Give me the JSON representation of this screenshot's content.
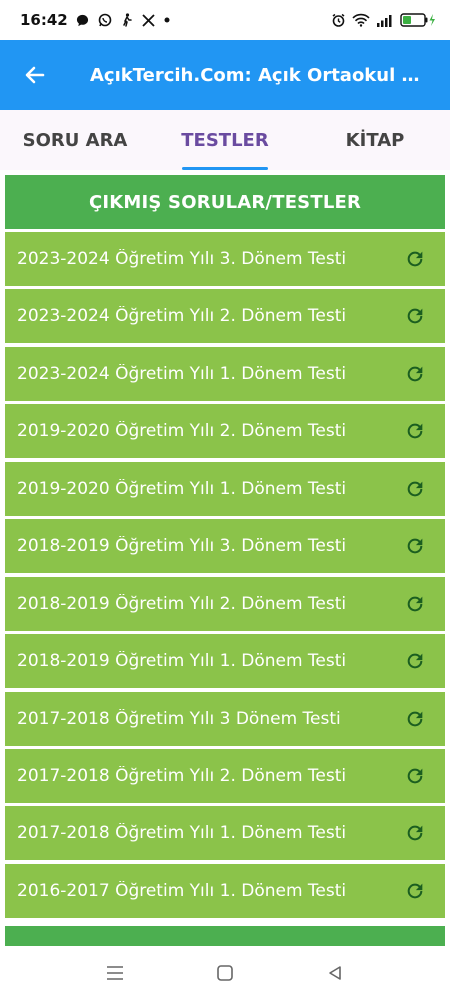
{
  "status_bar": {
    "time": "16:42",
    "left_icons": [
      "chat-bubble-icon",
      "whatsapp-icon",
      "walking-person-icon",
      "x-logo-icon",
      "dot-icon"
    ],
    "right_icons": [
      "alarm-icon",
      "wifi-icon",
      "signal-icon",
      "battery-charging-icon"
    ]
  },
  "app_bar": {
    "title": "AçıkTercih.Com: Açık Ortaokul Uygulaması",
    "color": "#2196f3"
  },
  "tabs": [
    {
      "label": "SORU ARA",
      "active": false
    },
    {
      "label": "TESTLER",
      "active": true
    },
    {
      "label": "KİTAP",
      "active": false
    }
  ],
  "section": {
    "header": "ÇIKMIŞ SORULAR/TESTLER",
    "items": [
      {
        "label": "2023-2024 Öğretim Yılı 3. Dönem Testi"
      },
      {
        "label": "2023-2024 Öğretim Yılı 2. Dönem Testi"
      },
      {
        "label": "2023-2024 Öğretim Yılı 1. Dönem Testi"
      },
      {
        "label": "2019-2020 Öğretim Yılı 2. Dönem Testi"
      },
      {
        "label": "2019-2020 Öğretim Yılı 1. Dönem Testi"
      },
      {
        "label": "2018-2019 Öğretim Yılı 3. Dönem Testi"
      },
      {
        "label": "2018-2019 Öğretim Yılı 2. Dönem Testi"
      },
      {
        "label": "2018-2019 Öğretim Yılı 1. Dönem Testi"
      },
      {
        "label": "2017-2018 Öğretim Yılı 3 Dönem Testi"
      },
      {
        "label": "2017-2018 Öğretim Yılı 2. Dönem Testi"
      },
      {
        "label": "2017-2018 Öğretim Yılı 1. Dönem Testi"
      },
      {
        "label": "2016-2017 Öğretim Yılı 1. Dönem Testi"
      }
    ],
    "header_color": "#4caf50",
    "item_color": "#8bc34a",
    "icon_color": "#1b5e20"
  },
  "nav_bar": {
    "buttons": [
      "menu-icon",
      "home-square-icon",
      "back-triangle-icon"
    ]
  }
}
